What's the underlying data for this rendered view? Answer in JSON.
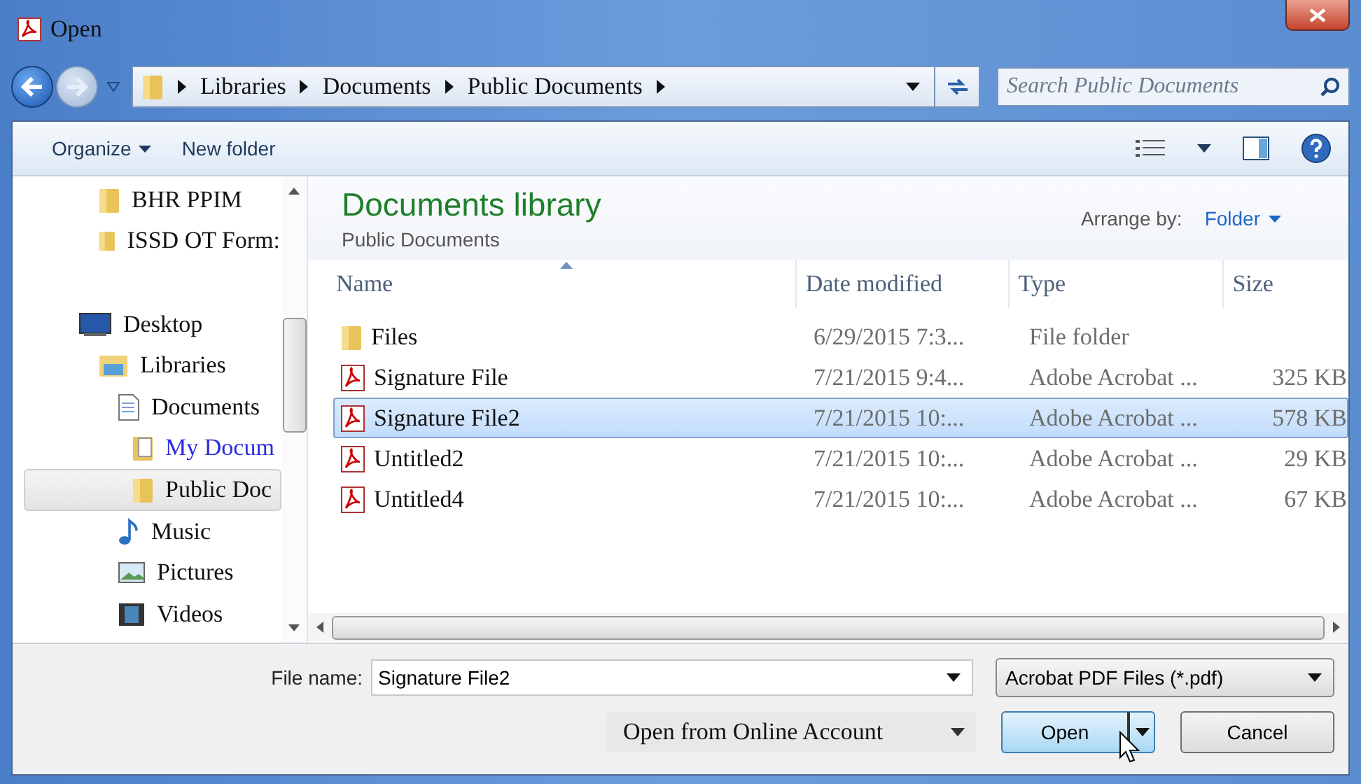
{
  "window": {
    "title": "Open"
  },
  "address": {
    "crumbs": [
      "Libraries",
      "Documents",
      "Public Documents"
    ]
  },
  "search": {
    "placeholder": "Search Public Documents"
  },
  "toolbar": {
    "organize": "Organize",
    "new_folder": "New folder"
  },
  "sidebar": {
    "favorites": [
      {
        "label": "BHR PPIM",
        "kind": "folder",
        "selected": false,
        "hot": false
      },
      {
        "label": "ISSD OT Form:",
        "kind": "folder",
        "selected": false,
        "hot": false
      }
    ],
    "tree": [
      {
        "label": "Desktop",
        "kind": "desktop",
        "selected": false,
        "hot": false,
        "children": [
          {
            "label": "Libraries",
            "kind": "libraries",
            "selected": false,
            "hot": false,
            "children": [
              {
                "label": "Documents",
                "kind": "document",
                "selected": false,
                "hot": false,
                "children": [
                  {
                    "label": "My Docum",
                    "kind": "docfolder",
                    "selected": false,
                    "hot": true
                  },
                  {
                    "label": "Public Doc",
                    "kind": "folder",
                    "selected": true,
                    "hot": false
                  }
                ]
              },
              {
                "label": "Music",
                "kind": "music",
                "selected": false,
                "hot": false
              },
              {
                "label": "Pictures",
                "kind": "pictures",
                "selected": false,
                "hot": false
              },
              {
                "label": "Videos",
                "kind": "videos",
                "selected": false,
                "hot": false
              }
            ]
          }
        ]
      }
    ]
  },
  "library": {
    "title": "Documents library",
    "subtitle": "Public Documents",
    "arrange_label": "Arrange by:",
    "arrange_value": "Folder"
  },
  "table": {
    "columns": [
      "Name",
      "Date modified",
      "Type",
      "Size"
    ],
    "rows": [
      {
        "name": "Files",
        "date": "6/29/2015 7:3...",
        "type": "File folder",
        "size": "",
        "kind": "folder",
        "selected": false
      },
      {
        "name": "Signature File",
        "date": "7/21/2015 9:4...",
        "type": "Adobe Acrobat ...",
        "size": "325 KB",
        "kind": "pdf",
        "selected": false
      },
      {
        "name": "Signature File2",
        "date": "7/21/2015 10:...",
        "type": "Adobe Acrobat ...",
        "size": "578 KB",
        "kind": "pdf",
        "selected": true
      },
      {
        "name": "Untitled2",
        "date": "7/21/2015 10:...",
        "type": "Adobe Acrobat ...",
        "size": "29 KB",
        "kind": "pdf",
        "selected": false
      },
      {
        "name": "Untitled4",
        "date": "7/21/2015 10:...",
        "type": "Adobe Acrobat ...",
        "size": "67 KB",
        "kind": "pdf",
        "selected": false
      }
    ]
  },
  "footer": {
    "file_name_label": "File name:",
    "file_name": "Signature File2",
    "file_type": "Acrobat PDF Files (*.pdf)",
    "online": "Open from Online Account",
    "open": "Open",
    "cancel": "Cancel"
  }
}
